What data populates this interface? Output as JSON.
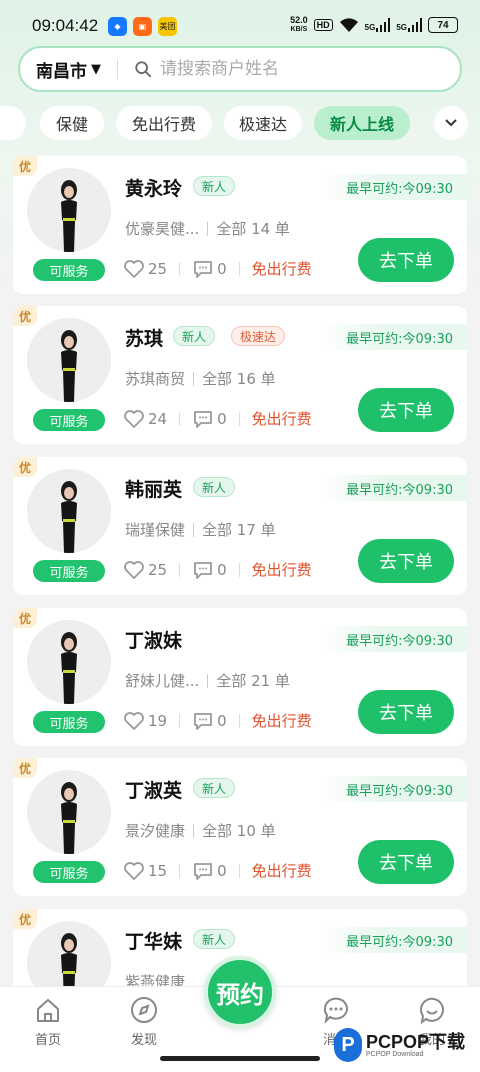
{
  "status_bar": {
    "time": "09:04:42",
    "apps": [
      {
        "icon": "app-icon-blue",
        "label": "",
        "color": "#1677ff"
      },
      {
        "icon": "app-icon-orange",
        "label": "",
        "color": "#ff6a1a"
      },
      {
        "icon": "meituan-icon",
        "label": "美团",
        "color": "#f7c600"
      }
    ],
    "net_speed": "52.0",
    "net_unit": "KB/S",
    "hd": "HD",
    "signal_1": "5G",
    "signal_2": "5G",
    "battery": "74"
  },
  "search": {
    "city": "南昌市",
    "placeholder": "请搜索商户姓名"
  },
  "tabs": [
    {
      "label": "保健",
      "active": false
    },
    {
      "label": "免出行费",
      "active": false
    },
    {
      "label": "极速达",
      "active": false
    },
    {
      "label": "新人上线",
      "active": true
    }
  ],
  "common": {
    "badge": "优",
    "serve_label": "可服务",
    "order_label": "去下单",
    "free_fee_label": "免出行费",
    "new_tag": "新人",
    "fast_tag": "极速达"
  },
  "cards": [
    {
      "name": "黄永玲",
      "tags": [
        "新人"
      ],
      "earliest": "最早可约:今09:30",
      "shop": "优豪昊健...",
      "orders": "全部 14 单",
      "likes": "25",
      "comments": "0"
    },
    {
      "name": "苏琪",
      "tags": [
        "新人",
        "极速达"
      ],
      "earliest": "最早可约:今09:30",
      "shop": "苏琪商贸",
      "orders": "全部 16 单",
      "likes": "24",
      "comments": "0"
    },
    {
      "name": "韩丽英",
      "tags": [
        "新人"
      ],
      "earliest": "最早可约:今09:30",
      "shop": "瑞瑾保健",
      "orders": "全部 17 单",
      "likes": "25",
      "comments": "0"
    },
    {
      "name": "丁淑妹",
      "tags": [],
      "earliest": "最早可约:今09:30",
      "shop": "舒妹儿健...",
      "orders": "全部 21 单",
      "likes": "19",
      "comments": "0"
    },
    {
      "name": "丁淑英",
      "tags": [
        "新人"
      ],
      "earliest": "最早可约:今09:30",
      "shop": "景汐健康",
      "orders": "全部 10 单",
      "likes": "15",
      "comments": "0"
    },
    {
      "name": "丁华妹",
      "tags": [
        "新人"
      ],
      "earliest": "最早可约:今09:30",
      "shop": "紫燕健康",
      "orders": "",
      "likes": "",
      "comments": ""
    }
  ],
  "bottom_nav": {
    "items": [
      {
        "label": "首页",
        "icon": "home-icon"
      },
      {
        "label": "发现",
        "icon": "compass-icon"
      },
      {
        "label": "消息",
        "icon": "chat-bubble-icon"
      },
      {
        "label": "我的",
        "icon": "profile-bubble-icon"
      }
    ],
    "fab_label": "预约"
  },
  "watermark": {
    "brand": "PCPOP下载",
    "sub": "PCPOP Download"
  },
  "colors": {
    "accent": "#1ec06a",
    "tag_new": "#17a25a",
    "tag_fast": "#e25a33",
    "free_fee": "#e2522d",
    "badge": "#c98a2a"
  }
}
